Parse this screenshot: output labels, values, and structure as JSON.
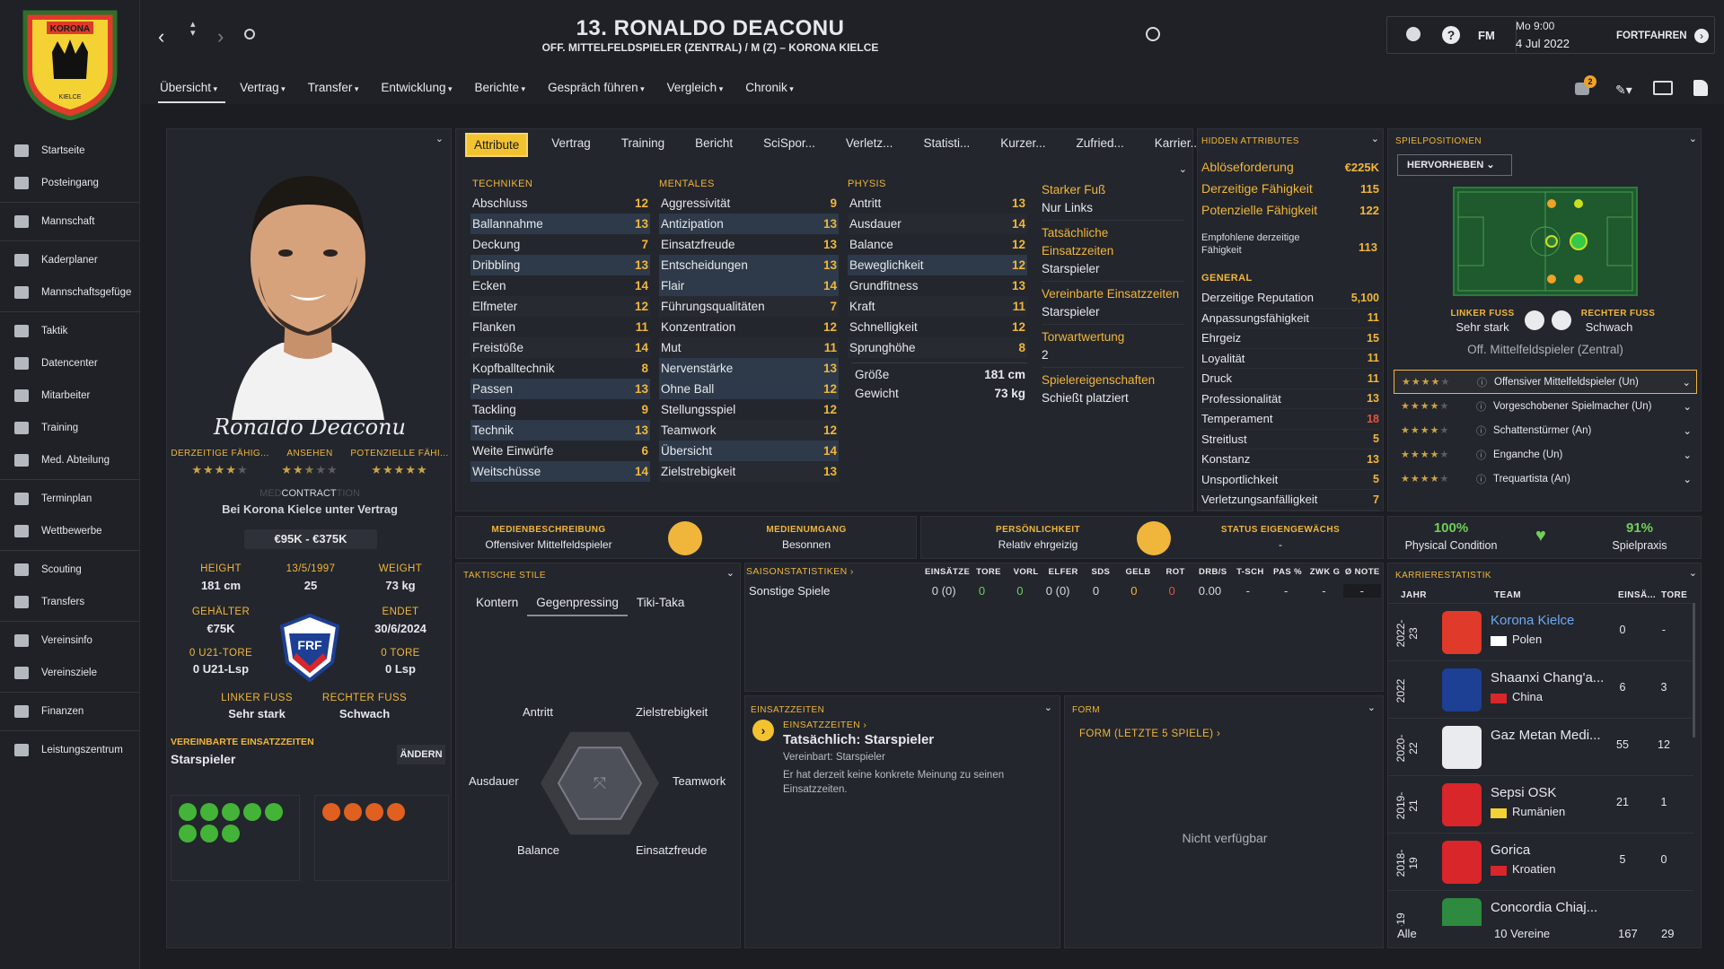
{
  "header": {
    "title": "13. RONALDO DEACONU",
    "subtitle": "OFF. MITTELFELDSPIELER (ZENTRAL) / M (Z) – KORONA KIELCE",
    "date_time": "Mo 9:00",
    "date": "4 Jul 2022",
    "continue_label": "FORTFAHREN",
    "fm_label": "FM",
    "notif_count": "2",
    "crest_text_top": "KORONA",
    "crest_text_bottom": "KIELCE"
  },
  "menu": [
    {
      "label": "Übersicht"
    },
    {
      "label": "Vertrag"
    },
    {
      "label": "Transfer"
    },
    {
      "label": "Entwicklung"
    },
    {
      "label": "Berichte"
    },
    {
      "label": "Gespräch führen"
    },
    {
      "label": "Vergleich"
    },
    {
      "label": "Chronik"
    }
  ],
  "sidebar": [
    {
      "label": "Startseite"
    },
    {
      "label": "Posteingang"
    },
    {
      "label": "Mannschaft"
    },
    {
      "label": "Kaderplaner"
    },
    {
      "label": "Mannschaftsgefüge"
    },
    {
      "label": "Taktik"
    },
    {
      "label": "Datencenter"
    },
    {
      "label": "Mitarbeiter"
    },
    {
      "label": "Training"
    },
    {
      "label": "Med. Abteilung"
    },
    {
      "label": "Terminplan"
    },
    {
      "label": "Wettbewerbe"
    },
    {
      "label": "Scouting"
    },
    {
      "label": "Transfers"
    },
    {
      "label": "Vereinsinfo"
    },
    {
      "label": "Vereinsziele"
    },
    {
      "label": "Finanzen"
    },
    {
      "label": "Leistungszentrum"
    }
  ],
  "profile": {
    "signature": "Ronaldo Deaconu",
    "cur_ability_label": "DERZEITIGE FÄHIG...",
    "reputation_label": "ANSEHEN",
    "pot_ability_label": "POTENZIELLE FÄHI...",
    "cur_stars": 4,
    "rep_stars": 2.5,
    "pot_stars": 4.5,
    "contract_label": "CONTRACT",
    "contract_ghost": "MED",
    "contract_ghost2": "TION",
    "contract_text": "Bei Korona Kielce unter Vertrag",
    "value": "€95K - €375K",
    "height_label": "HEIGHT",
    "height": "181 cm",
    "dob_label": "13/5/1997",
    "age": "25",
    "weight_label": "WEIGHT",
    "weight": "73 kg",
    "wage_label": "GEHÄLTER",
    "wage": "€75K",
    "ends_label": "ENDET",
    "ends": "30/6/2024",
    "u21_goals_label": "0 U21-TORE",
    "u21_apps": "0 U21-Lsp",
    "goals_label": "0 TORE",
    "apps": "0 Lsp",
    "left_foot_label": "LINKER FUSS",
    "left_foot": "Sehr stark",
    "right_foot_label": "RECHTER FUSS",
    "right_foot": "Schwach",
    "agreed_label": "VEREINBARTE EINSATZZEITEN",
    "agreed_value": "Starspieler",
    "change_label": "ÄNDERN",
    "fed_label": "FRF"
  },
  "tabs": [
    {
      "label": "Attribute"
    },
    {
      "label": "Vertrag"
    },
    {
      "label": "Training"
    },
    {
      "label": "Bericht"
    },
    {
      "label": "SciSpor..."
    },
    {
      "label": "Verletz..."
    },
    {
      "label": "Statisti..."
    },
    {
      "label": "Kurzer..."
    },
    {
      "label": "Zufried..."
    },
    {
      "label": "Karrier..."
    }
  ],
  "attributes": {
    "tech_title": "TECHNIKEN",
    "mental_title": "MENTALES",
    "phys_title": "PHYSIS",
    "technical": [
      {
        "name": "Abschluss",
        "value": "12"
      },
      {
        "name": "Ballannahme",
        "value": "13"
      },
      {
        "name": "Deckung",
        "value": "7"
      },
      {
        "name": "Dribbling",
        "value": "13"
      },
      {
        "name": "Ecken",
        "value": "14"
      },
      {
        "name": "Elfmeter",
        "value": "12"
      },
      {
        "name": "Flanken",
        "value": "11"
      },
      {
        "name": "Freistöße",
        "value": "14"
      },
      {
        "name": "Kopfballtechnik",
        "value": "8"
      },
      {
        "name": "Passen",
        "value": "13"
      },
      {
        "name": "Tackling",
        "value": "9"
      },
      {
        "name": "Technik",
        "value": "13"
      },
      {
        "name": "Weite Einwürfe",
        "value": "6"
      },
      {
        "name": "Weitschüsse",
        "value": "14"
      }
    ],
    "mental": [
      {
        "name": "Aggressivität",
        "value": "9"
      },
      {
        "name": "Antizipation",
        "value": "13"
      },
      {
        "name": "Einsatzfreude",
        "value": "13"
      },
      {
        "name": "Entscheidungen",
        "value": "13"
      },
      {
        "name": "Flair",
        "value": "14"
      },
      {
        "name": "Führungsqualitäten",
        "value": "7"
      },
      {
        "name": "Konzentration",
        "value": "12"
      },
      {
        "name": "Mut",
        "value": "11"
      },
      {
        "name": "Nervenstärke",
        "value": "13"
      },
      {
        "name": "Ohne Ball",
        "value": "12"
      },
      {
        "name": "Stellungsspiel",
        "value": "12"
      },
      {
        "name": "Teamwork",
        "value": "12"
      },
      {
        "name": "Übersicht",
        "value": "14"
      },
      {
        "name": "Zielstrebigkeit",
        "value": "13"
      }
    ],
    "physical": [
      {
        "name": "Antritt",
        "value": "13"
      },
      {
        "name": "Ausdauer",
        "value": "14"
      },
      {
        "name": "Balance",
        "value": "12"
      },
      {
        "name": "Beweglichkeit",
        "value": "12"
      },
      {
        "name": "Grundfitness",
        "value": "13"
      },
      {
        "name": "Kraft",
        "value": "11"
      },
      {
        "name": "Schnelligkeit",
        "value": "12"
      },
      {
        "name": "Sprunghöhe",
        "value": "8"
      }
    ],
    "size_label": "Größe",
    "size": "181 cm",
    "weight_label": "Gewicht",
    "weight": "73 kg"
  },
  "info_col": {
    "strong_foot_label": "Starker Fuß",
    "strong_foot": "Nur Links",
    "actual_time_label": "Tatsächliche Einsatzzeiten",
    "actual_time": "Starspieler",
    "agreed_time_label": "Vereinbarte Einsatzzeiten",
    "agreed_time": "Starspieler",
    "gk_label": "Torwartwertung",
    "gk": "2",
    "traits_label": "Spielereigenschaften",
    "trait": "Schießt platziert"
  },
  "hidden": {
    "title": "HIDDEN ATTRIBUTES",
    "top": [
      {
        "name": "Ablöseforderung",
        "value": "€225K"
      },
      {
        "name": "Derzeitige Fähigkeit",
        "value": "115"
      },
      {
        "name": "Potenzielle Fähigkeit",
        "value": "122"
      }
    ],
    "recommended_label": "Empfohlene derzeitige Fähigkeit",
    "recommended": "113",
    "general_title": "GENERAL",
    "general": [
      {
        "name": "Derzeitige Reputation",
        "value": "5,100",
        "color": "#f0b63b"
      },
      {
        "name": "Anpassungsfähigkeit",
        "value": "11",
        "color": "#f0b63b"
      },
      {
        "name": "Ehrgeiz",
        "value": "15",
        "color": "#f0b63b"
      },
      {
        "name": "Loyalität",
        "value": "11",
        "color": "#f0b63b"
      },
      {
        "name": "Druck",
        "value": "11",
        "color": "#f0b63b"
      },
      {
        "name": "Professionalität",
        "value": "13",
        "color": "#f0b63b"
      },
      {
        "name": "Temperament",
        "value": "18",
        "color": "#e2553d"
      },
      {
        "name": "Streitlust",
        "value": "5",
        "color": "#f0b63b"
      },
      {
        "name": "Konstanz",
        "value": "13",
        "color": "#f0b63b"
      },
      {
        "name": "Unsportlichkeit",
        "value": "5",
        "color": "#f0b63b"
      },
      {
        "name": "Verletzungsanfälligkeit",
        "value": "7",
        "color": "#f0b63b"
      }
    ]
  },
  "positions": {
    "title": "SPIELPOSITIONEN",
    "highlight_label": "HERVORHEBEN",
    "left_foot_label": "LINKER FUSS",
    "left_foot": "Sehr stark",
    "right_foot_label": "RECHTER FUSS",
    "right_foot": "Schwach",
    "position": "Off. Mittelfeldspieler (Zentral)",
    "roles": [
      {
        "label": "Offensiver Mittelfeldspieler (Un)",
        "stars": 4
      },
      {
        "label": "Vorgeschobener Spielmacher (Un)",
        "stars": 4
      },
      {
        "label": "Schattenstürmer (An)",
        "stars": 4
      },
      {
        "label": "Enganche (Un)",
        "stars": 4
      },
      {
        "label": "Trequartista (An)",
        "stars": 4
      }
    ]
  },
  "info_strip": {
    "media_desc_label": "MEDIENBESCHREIBUNG",
    "media_desc": "Offensiver Mittelfeldspieler",
    "media_handling_label": "MEDIENUMGANG",
    "media_handling": "Besonnen",
    "personality_label": "PERSÖNLICHKEIT",
    "personality": "Relativ ehrgeizig",
    "homegrown_label": "STATUS EIGENGEWÄCHS",
    "homegrown": "-",
    "condition": "100%",
    "condition_label": "Physical Condition",
    "match_practice": "91%",
    "match_practice_label": "Spielpraxis"
  },
  "tactical": {
    "title": "TAKTISCHE STILE",
    "tabs": [
      {
        "label": "Kontern"
      },
      {
        "label": "Gegenpressing"
      },
      {
        "label": "Tiki-Taka"
      }
    ],
    "labels": {
      "top_left": "Antritt",
      "top_right": "Zielstrebigkeit",
      "mid_left": "Ausdauer",
      "mid_right": "Teamwork",
      "bot_left": "Balance",
      "bot_right": "Einsatzfreude"
    }
  },
  "season": {
    "title": "SAISONSTATISTIKEN",
    "headers": [
      "EINSÄTZE",
      "TORE",
      "VORL",
      "ELFER",
      "SDS",
      "GELB",
      "ROT",
      "DRB/S",
      "T-SCH",
      "PAS %",
      "ZWK G",
      "Ø NOTE"
    ],
    "row_label": "Sonstige Spiele",
    "row": [
      "0 (0)",
      "0",
      "0",
      "0 (0)",
      "0",
      "0",
      "0",
      "0.00",
      "-",
      "-",
      "-",
      "-"
    ]
  },
  "playing_time": {
    "title": "EINSATZZEITEN",
    "link": "EINSATZZEITEN",
    "heading": "Tatsächlich: Starspieler",
    "agreed": "Vereinbart: Starspieler",
    "text": "Er hat derzeit keine konkrete Meinung zu seinen Einsatzzeiten."
  },
  "form": {
    "title": "FORM",
    "link": "FORM (LETZTE 5 SPIELE)",
    "empty": "Nicht verfügbar"
  },
  "career": {
    "title": "KARRIERESTATISTIK",
    "col_year": "JAHR",
    "col_team": "TEAM",
    "col_apps": "EINSÄ...",
    "col_goals": "TORE",
    "rows": [
      {
        "year": "2022-23",
        "team": "Korona Kielce",
        "country": "Polen",
        "apps": "0",
        "goals": "-"
      },
      {
        "year": "2022",
        "team": "Shaanxi Chang'a...",
        "country": "China",
        "apps": "6",
        "goals": "3"
      },
      {
        "year": "2020-22",
        "team": "Gaz Metan Medi...",
        "country": "",
        "apps": "55",
        "goals": "12"
      },
      {
        "year": "2019-21",
        "team": "Sepsi OSK",
        "country": "Rumänien",
        "apps": "21",
        "goals": "1"
      },
      {
        "year": "2018-19",
        "team": "Gorica",
        "country": "Kroatien",
        "apps": "5",
        "goals": "0"
      },
      {
        "year": "-19",
        "team": "Concordia Chiaj...",
        "country": "",
        "apps": "",
        "goals": ""
      }
    ],
    "footer_label": "Alle",
    "footer_clubs": "10 Vereine",
    "footer_apps": "167",
    "footer_goals": "29"
  },
  "chart_data": {
    "type": "radar",
    "categories": [
      "Antritt",
      "Zielstrebigkeit",
      "Teamwork",
      "Einsatzfreude",
      "Balance",
      "Ausdauer"
    ],
    "title": "TAKTISCHE STILE"
  },
  "colors": {
    "accent": "#f0b63b",
    "bg": "#1b1d22",
    "panel": "#23262c",
    "green": "#6fcf58",
    "red": "#e2553d"
  }
}
